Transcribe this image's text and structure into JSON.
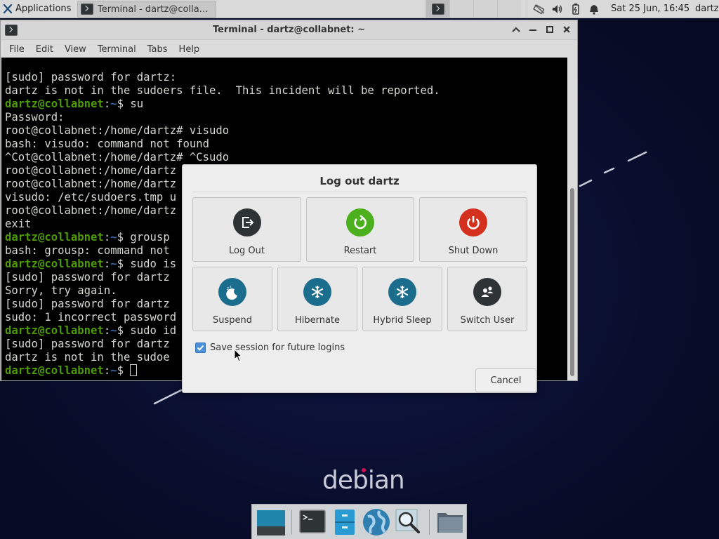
{
  "panel": {
    "applications_label": "Applications",
    "task_title": "Terminal - dartz@collab...",
    "clock": "Sat 25 Jun, 16:45",
    "user": "dartz"
  },
  "terminal": {
    "title": "Terminal - dartz@collabnet: ~",
    "menu": [
      "File",
      "Edit",
      "View",
      "Terminal",
      "Tabs",
      "Help"
    ],
    "prompt_user": "dartz@collabnet",
    "prompt_sep": ":",
    "prompt_path": "~",
    "prompt_end": "$ ",
    "lines": [
      {
        "t": "plain",
        "text": "[sudo] password for dartz:"
      },
      {
        "t": "plain",
        "text": "dartz is not in the sudoers file.  This incident will be reported."
      },
      {
        "t": "prompt",
        "text": "su"
      },
      {
        "t": "plain",
        "text": "Password:"
      },
      {
        "t": "plain",
        "text": "root@collabnet:/home/dartz# visudo"
      },
      {
        "t": "plain",
        "text": "bash: visudo: command not found"
      },
      {
        "t": "plain",
        "text": "^Cot@collabnet:/home/dartz# ^Csudo"
      },
      {
        "t": "plain",
        "text": "root@collabnet:/home/dartz"
      },
      {
        "t": "plain",
        "text": "root@collabnet:/home/dartz"
      },
      {
        "t": "plain",
        "text": "visudo: /etc/sudoers.tmp u"
      },
      {
        "t": "plain",
        "text": "root@collabnet:/home/dartz"
      },
      {
        "t": "plain",
        "text": "exit"
      },
      {
        "t": "prompt",
        "text": "grousp"
      },
      {
        "t": "plain",
        "text": "bash: grousp: command not"
      },
      {
        "t": "prompt",
        "text": "sudo is"
      },
      {
        "t": "plain",
        "text": "[sudo] password for dartz"
      },
      {
        "t": "plain",
        "text": "Sorry, try again."
      },
      {
        "t": "plain",
        "text": "[sudo] password for dartz"
      },
      {
        "t": "plain",
        "text": "sudo: 1 incorrect password"
      },
      {
        "t": "prompt",
        "text": "sudo id"
      },
      {
        "t": "plain",
        "text": "[sudo] password for dartz"
      },
      {
        "t": "plain",
        "text": "dartz is not in the sudoe"
      },
      {
        "t": "prompt_cursor",
        "text": ""
      }
    ]
  },
  "dialog": {
    "title": "Log out dartz",
    "buttons": {
      "logout": "Log Out",
      "restart": "Restart",
      "shutdown": "Shut Down",
      "suspend": "Suspend",
      "hibernate": "Hibernate",
      "hybrid_sleep": "Hybrid Sleep",
      "switch_user": "Switch User"
    },
    "save_session_label": "Save session for future logins",
    "save_session_checked": true,
    "cancel": "Cancel"
  },
  "desktop": {
    "logo_text": "debian"
  },
  "colors": {
    "logout_icon": "#2e3436",
    "restart_icon": "#4caf1e",
    "shutdown_icon": "#d4301e",
    "suspend_icon": "#1a6d8c",
    "hibernate_icon": "#1a6d8c",
    "hybrid_icon": "#1a6d8c",
    "switch_icon": "#2e3436",
    "checkbox": "#4a90d9"
  },
  "dock": {
    "items": [
      "show-desktop-icon",
      "terminal-icon",
      "file-cabinet-icon",
      "web-browser-icon",
      "app-finder-icon",
      "folder-icon"
    ]
  }
}
